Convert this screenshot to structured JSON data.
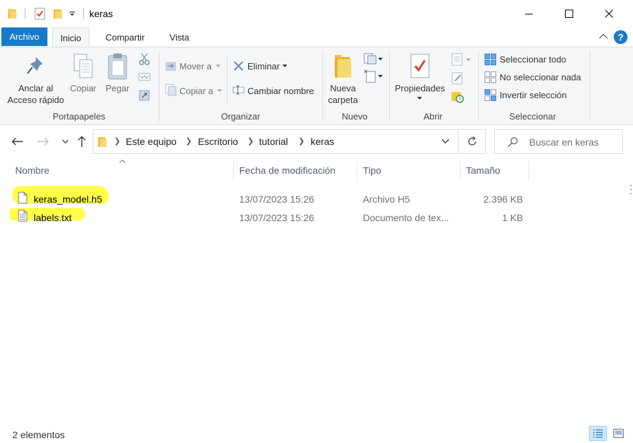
{
  "window": {
    "title": "keras",
    "minimize_glyph": "—",
    "maximize_glyph": "☐",
    "close_glyph": "✕"
  },
  "ribbon_tabs": {
    "file": "Archivo",
    "home": "Inicio",
    "share": "Compartir",
    "view": "Vista",
    "help": "?"
  },
  "ribbon": {
    "clipboard": {
      "pin_line1": "Anclar al",
      "pin_line2": "Acceso rápido",
      "copy": "Copiar",
      "paste": "Pegar",
      "group": "Portapapeles"
    },
    "organize": {
      "move_to": "Mover a",
      "copy_to": "Copiar a",
      "delete": "Eliminar",
      "rename": "Cambiar nombre",
      "group": "Organizar"
    },
    "new": {
      "new_folder_line1": "Nueva",
      "new_folder_line2": "carpeta",
      "group": "Nuevo"
    },
    "open": {
      "properties": "Propiedades",
      "group": "Abrir"
    },
    "select": {
      "select_all": "Seleccionar todo",
      "select_none": "No seleccionar nada",
      "invert": "Invertir selección",
      "group": "Seleccionar"
    }
  },
  "address": {
    "breadcrumbs": [
      "Este equipo",
      "Escritorio",
      "tutorial",
      "keras"
    ],
    "search_placeholder": "Buscar en keras"
  },
  "columns": {
    "name": "Nombre",
    "modified": "Fecha de modificación",
    "type": "Tipo",
    "size": "Tamaño"
  },
  "files": [
    {
      "name": "keras_model.h5",
      "modified": "13/07/2023 15:26",
      "type": "Archivo H5",
      "size": "2.396 KB"
    },
    {
      "name": "labels.txt",
      "modified": "13/07/2023 15:26",
      "type": "Documento de tex...",
      "size": "1 KB"
    }
  ],
  "status": {
    "count": "2 elementos"
  },
  "colors": {
    "accent": "#1979ca",
    "highlight": "#ffff33",
    "folder": "#f2c94c"
  }
}
